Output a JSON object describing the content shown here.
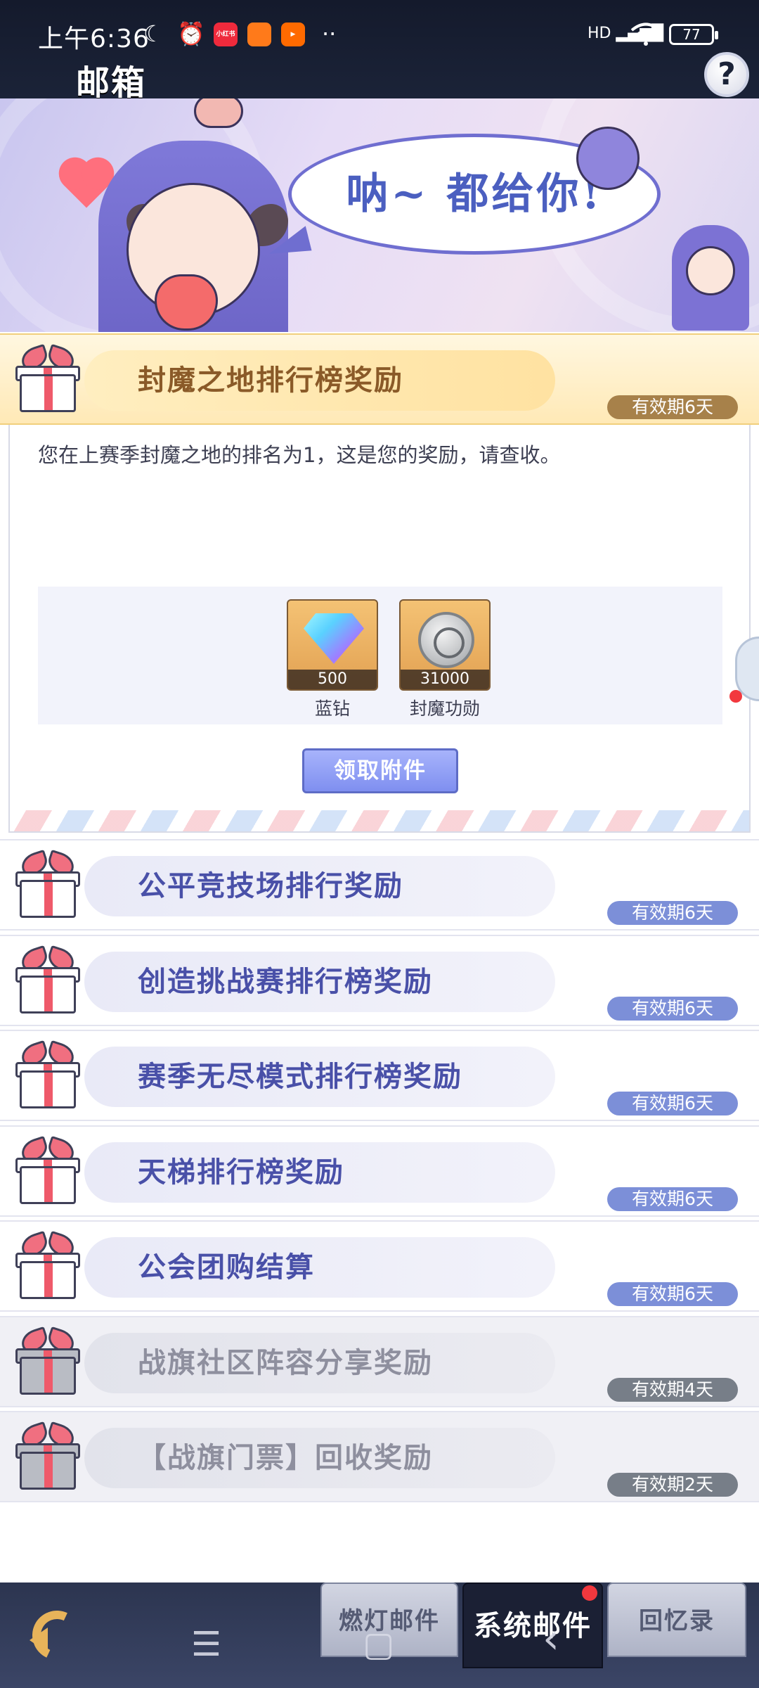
{
  "status_bar": {
    "time": "上午6:36",
    "moon_icon": "☾",
    "alarm_icon": "⏰",
    "apps": [
      {
        "label": "小红书",
        "color": "#ef2a3c"
      },
      {
        "label": "",
        "color": "#ff7a1a"
      },
      {
        "label": "",
        "color": "#ff6a00"
      }
    ],
    "more": "··",
    "signal": "HD ▂▄▆█",
    "wifi_icon": "wifi",
    "battery": "77"
  },
  "header": {
    "title": "邮箱",
    "help_label": "?"
  },
  "banner": {
    "speech": "呐~ 都给你!"
  },
  "open_mail": {
    "title": "封魔之地排行榜奖励",
    "expiry": "有效期6天",
    "message": "您在上赛季封魔之地的排名为1，这是您的奖励，请查收。",
    "attachments": [
      {
        "name": "蓝钻",
        "count": "500",
        "icon": "blue-diamond-icon"
      },
      {
        "name": "封魔功勋",
        "count": "31000",
        "icon": "silver-medal-icon"
      }
    ],
    "claim_label": "领取附件"
  },
  "mails": [
    {
      "title": "公平竞技场排行奖励",
      "expiry": "有效期6天",
      "expired": false
    },
    {
      "title": "创造挑战赛排行榜奖励",
      "expiry": "有效期6天",
      "expired": false
    },
    {
      "title": "赛季无尽模式排行榜奖励",
      "expiry": "有效期6天",
      "expired": false
    },
    {
      "title": "天梯排行榜奖励",
      "expiry": "有效期6天",
      "expired": false
    },
    {
      "title": "公会团购结算",
      "expiry": "有效期6天",
      "expired": false
    },
    {
      "title": "战旗社区阵容分享奖励",
      "expiry": "有效期4天",
      "expired": true
    },
    {
      "title": "【战旗门票】回收奖励",
      "expiry": "有效期2天",
      "expired": true
    }
  ],
  "tabs": [
    {
      "label": "燃灯邮件",
      "active": false
    },
    {
      "label": "系统邮件",
      "active": true
    },
    {
      "label": "回忆录",
      "active": false
    }
  ],
  "nav": {
    "menu_icon": "☰",
    "home_icon": "▢",
    "back_icon": "‹"
  },
  "colors": {
    "accent": "#4950a8",
    "open_badge": "#a7814a",
    "badge": "#7c8fd8",
    "expired_badge": "#777e88",
    "notification": "#f2383e"
  }
}
